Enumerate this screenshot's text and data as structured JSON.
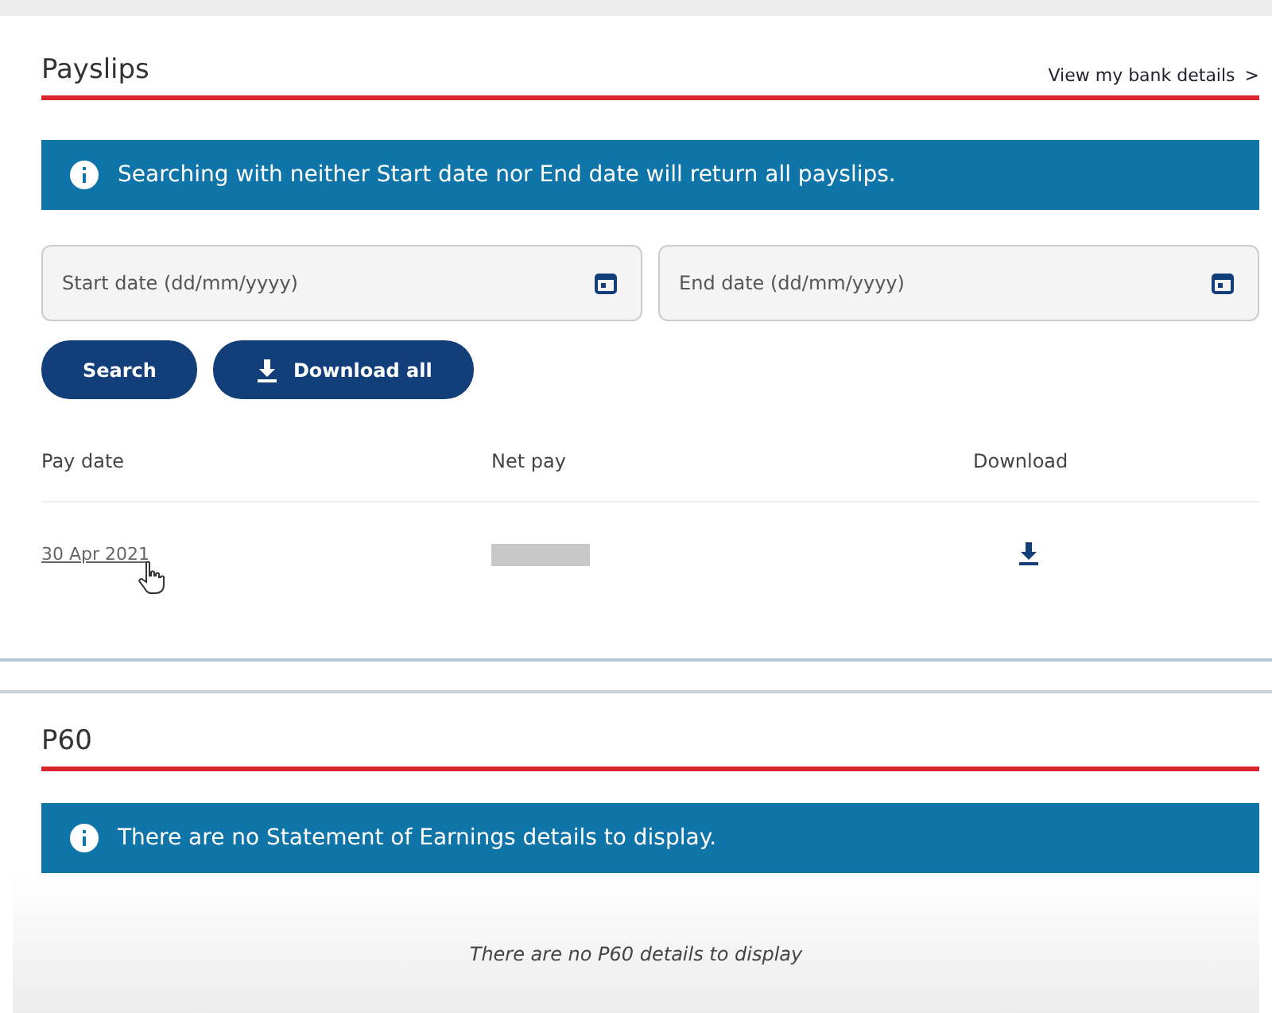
{
  "payslips": {
    "title": "Payslips",
    "bank_link": "View my bank details",
    "bank_link_chevron": ">",
    "info": "Searching with neither Start date nor End date will return all payslips.",
    "start_date": {
      "placeholder": "Start date (dd/mm/yyyy)"
    },
    "end_date": {
      "placeholder": "End date (dd/mm/yyyy)"
    },
    "buttons": [
      {
        "label": "Search",
        "kind": "plain"
      },
      {
        "label": "Download all",
        "kind": "download"
      }
    ],
    "table": {
      "columns": [
        "Pay date",
        "Net pay",
        "Download"
      ],
      "rows": [
        {
          "pay_date": "30 Apr 2021",
          "net_pay_redacted": true
        }
      ]
    }
  },
  "p60": {
    "title": "P60",
    "info": "There are no Statement of Earnings details to display.",
    "empty": "There are no P60 details to display"
  }
}
